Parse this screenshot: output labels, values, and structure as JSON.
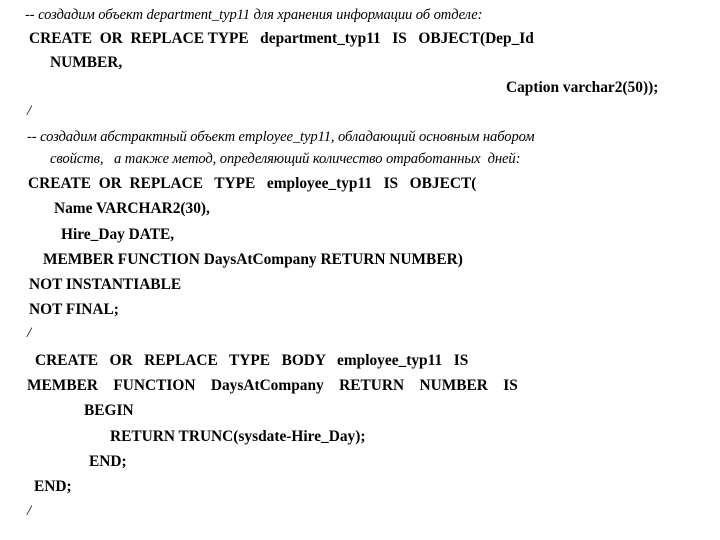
{
  "slide": {
    "title": "Oracle PL/SQL object type definition slide",
    "background_color": "#ffffff",
    "text_color": "#000000",
    "lines": [
      {
        "id": "comment_department",
        "text": "-- создадим объект department_typ11 для хранения информации об отделе:",
        "kind": "comment"
      },
      {
        "id": "create_department_typ11",
        "text": "CREATE  OR  REPLACE TYPE   department_typ11   IS   OBJECT(Dep_Id",
        "kind": "code"
      },
      {
        "id": "department_number_col",
        "text": "NUMBER,",
        "kind": "code"
      },
      {
        "id": "department_caption_col",
        "text": "Caption varchar2(50));",
        "kind": "code"
      },
      {
        "id": "slash_1",
        "text": "/",
        "kind": "slash"
      },
      {
        "id": "comment_employee_line1",
        "text": "-- создадим абстрактный объект employee_typ11, обладающий основным набором",
        "kind": "comment"
      },
      {
        "id": "comment_employee_line2",
        "text": "свойств,   а также метод, определяющий количество отработанных  дней:",
        "kind": "comment"
      },
      {
        "id": "create_employee_typ11",
        "text": "CREATE  OR  REPLACE   TYPE   employee_typ11   IS   OBJECT(",
        "kind": "code"
      },
      {
        "id": "employee_name_col",
        "text": "Name VARCHAR2(30),",
        "kind": "code"
      },
      {
        "id": "employee_hire_day_col",
        "text": "Hire_Day DATE,",
        "kind": "code"
      },
      {
        "id": "employee_member_function",
        "text": "MEMBER FUNCTION DaysAtCompany RETURN NUMBER)",
        "kind": "code"
      },
      {
        "id": "not_instantiable",
        "text": "NOT INSTANTIABLE",
        "kind": "code"
      },
      {
        "id": "not_final",
        "text": "NOT FINAL;",
        "kind": "code"
      },
      {
        "id": "slash_2",
        "text": "/",
        "kind": "slash"
      },
      {
        "id": "create_type_body",
        "text": "CREATE   OR   REPLACE   TYPE   BODY   employee_typ11   IS",
        "kind": "code"
      },
      {
        "id": "body_member_function",
        "text": "MEMBER    FUNCTION    DaysAtCompany    RETURN    NUMBER    IS",
        "kind": "code"
      },
      {
        "id": "begin_keyword",
        "text": "BEGIN",
        "kind": "code"
      },
      {
        "id": "return_trunc",
        "text": "RETURN TRUNC(sysdate-Hire_Day);",
        "kind": "code"
      },
      {
        "id": "end_inner",
        "text": "END;",
        "kind": "code"
      },
      {
        "id": "end_outer",
        "text": "END;",
        "kind": "code"
      },
      {
        "id": "slash_3",
        "text": "/",
        "kind": "slash"
      }
    ]
  }
}
